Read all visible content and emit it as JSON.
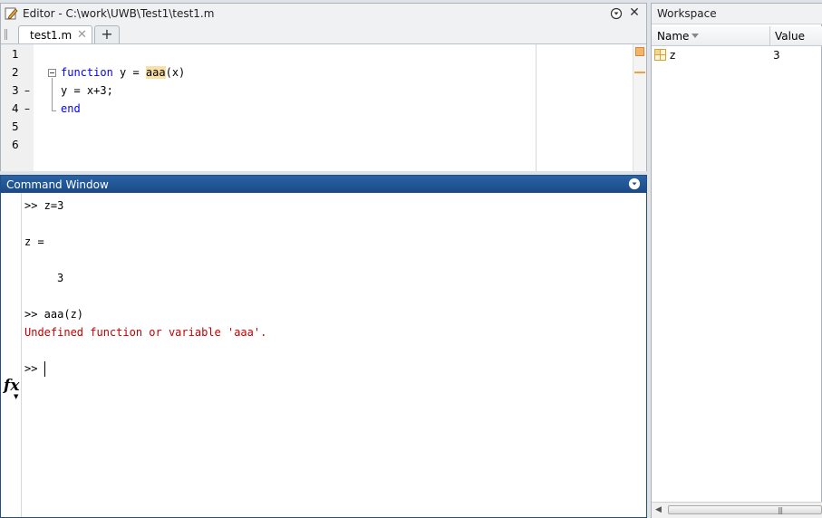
{
  "editor": {
    "title": "Editor - C:\\work\\UWB\\Test1\\test1.m",
    "tab_label": "test1.m",
    "add_tab_label": "+",
    "line_numbers": [
      "1",
      "2",
      "3",
      "4",
      "5",
      "6"
    ],
    "code": {
      "line2_keyword": "function",
      "line2_pre": " y = ",
      "line2_highlight": "aaa",
      "line2_post": "(x)",
      "line3": "y = x+3;",
      "line4_keyword": "end"
    },
    "exec_markers": [
      "–",
      "–"
    ]
  },
  "command_window": {
    "title": "Command Window",
    "lines": [
      ">> z=3",
      "z =",
      "3",
      ">> aaa(z)"
    ],
    "error": "Undefined function or variable 'aaa'.",
    "prompt": ">>",
    "fx_label": "fx"
  },
  "workspace": {
    "title": "Workspace",
    "col_name": "Name",
    "col_value": "Value",
    "variables": [
      {
        "name": "z",
        "value": "3"
      }
    ]
  },
  "colors": {
    "keyword": "#0000ff",
    "error": "#c00000",
    "cmd_titlebar": "#1f4f88",
    "highlight": "#fbe0a6"
  }
}
